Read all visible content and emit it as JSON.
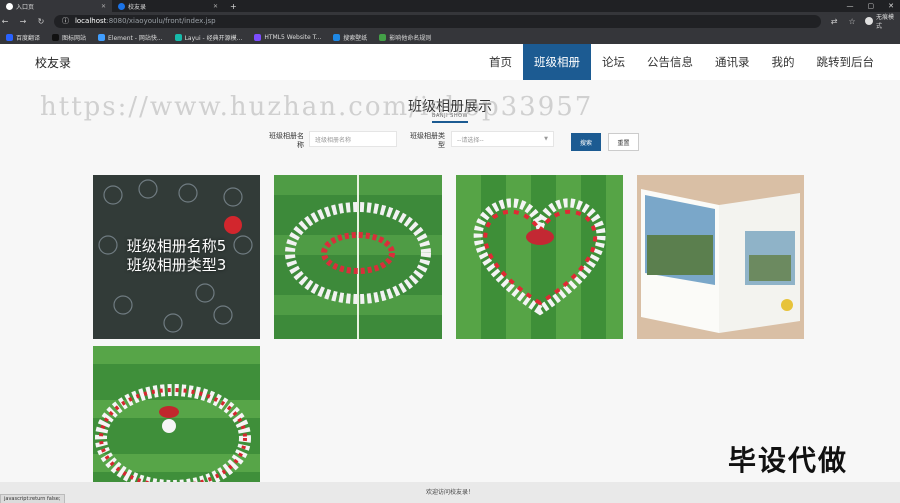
{
  "browser": {
    "tabs": [
      {
        "title": "入口页",
        "active": true
      },
      {
        "title": "校友录",
        "active": false
      }
    ],
    "new_tab": "+",
    "window_controls": [
      "—",
      "▢",
      "✕"
    ],
    "url_host": "localhost",
    "url_path": ":8080/xiaoyoulu/front/index.jsp",
    "profile_label": "无痕模式",
    "bookmarks": [
      {
        "label": "百度翻译",
        "color": "#2962ff"
      },
      {
        "label": "图标网站",
        "color": "#111111"
      },
      {
        "label": "Element - 网站快...",
        "color": "#409eff"
      },
      {
        "label": "Layui - 经典开源模...",
        "color": "#16baaa"
      },
      {
        "label": "HTML5 Website T...",
        "color": "#7c4dff"
      },
      {
        "label": "搜索壁纸",
        "color": "#1e88e5"
      },
      {
        "label": "影响他命名规则",
        "color": "#43a047"
      }
    ]
  },
  "site": {
    "brand": "校友录",
    "menu": [
      {
        "label": "首页",
        "active": false
      },
      {
        "label": "班级相册",
        "active": true
      },
      {
        "label": "论坛",
        "active": false
      },
      {
        "label": "公告信息",
        "active": false
      },
      {
        "label": "通讯录",
        "active": false
      },
      {
        "label": "我的",
        "active": false
      },
      {
        "label": "跳转到后台",
        "active": false
      }
    ],
    "watermark": "https://www.huzhan.com/ishop33957",
    "section_title": "班级相册展示",
    "section_subtitle": "BANJI SHOW",
    "search": {
      "name_label": "班级相册名称",
      "name_placeholder": "班级相册名称",
      "type_label": "班级相册类型",
      "type_selected": "--请选择--",
      "search_button": "搜索",
      "reset_button": "重置"
    },
    "albums": [
      {
        "caption_line1": "班级相册名称5",
        "caption_line2": "班级相册类型3",
        "photo": "circle-formation-hover"
      },
      {
        "caption_line1": "",
        "caption_line2": "",
        "photo": "circle-formation"
      },
      {
        "caption_line1": "",
        "caption_line2": "",
        "photo": "heart-formation"
      },
      {
        "caption_line1": "",
        "caption_line2": "",
        "photo": "open-photo-book"
      },
      {
        "caption_line1": "",
        "caption_line2": "",
        "photo": "ring-formation"
      }
    ],
    "corner_text": "毕设代做",
    "footer": "欢迎访问校友录！",
    "status_text": "javascript:return false;"
  }
}
